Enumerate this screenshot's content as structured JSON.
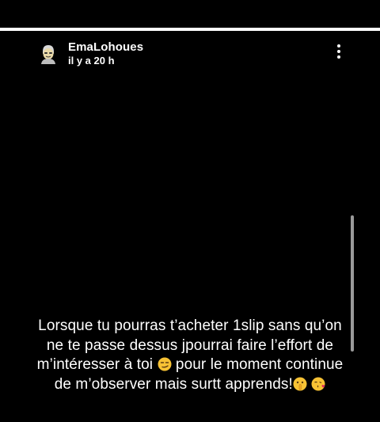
{
  "story": {
    "progress": 1.0,
    "username": "EmaLohoues",
    "timestamp": "il y a 20 h",
    "menu_icon": "more-vertical-icon",
    "caption": {
      "line1": "Lorsque tu pourras t’acheter 1slip sans qu’on",
      "line2": "ne te passe dessus jpourrai faire l’effort de",
      "line3_before_emoji": "m’intéresser à toi",
      "line3_after_emoji": "pour le moment continue",
      "line4": "de m’observer mais surtt apprends!"
    },
    "emojis": [
      "smirking-face-emoji",
      "shushing-face-emoji",
      "face-blowing-kiss-emoji"
    ]
  }
}
